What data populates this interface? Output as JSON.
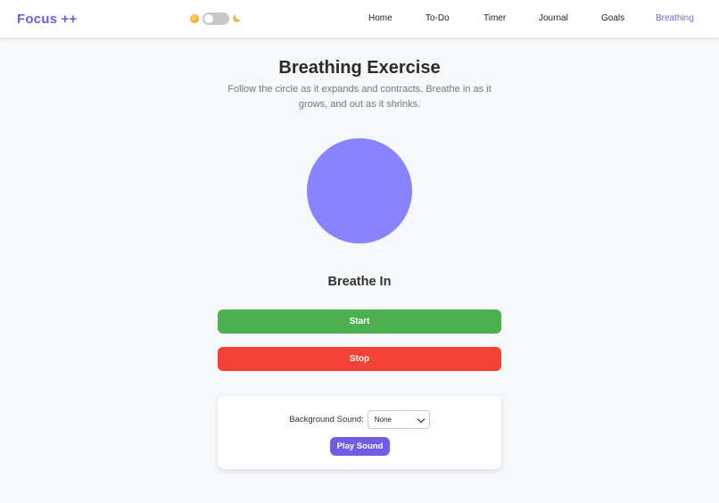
{
  "app": {
    "logo": "Focus ++"
  },
  "nav": {
    "items": [
      {
        "label": "Home",
        "active": false
      },
      {
        "label": "To-Do",
        "active": false
      },
      {
        "label": "Timer",
        "active": false
      },
      {
        "label": "Journal",
        "active": false
      },
      {
        "label": "Goals",
        "active": false
      },
      {
        "label": "Breathing",
        "active": true
      }
    ]
  },
  "theme": {
    "sun_icon": "sun-icon",
    "moon_icon": "moon-icon",
    "dark_mode": false
  },
  "main": {
    "title": "Breathing Exercise",
    "subtitle": "Follow the circle as it expands and contracts. Breathe in as it grows, and out as it shrinks.",
    "phase": "Breathe In",
    "start_label": "Start",
    "stop_label": "Stop"
  },
  "sound": {
    "label": "Background Sound:",
    "selected": "None",
    "play_label": "Play Sound"
  },
  "colors": {
    "accent": "#6f5fd6",
    "circle": "#8884ff",
    "start": "#4caf50",
    "stop": "#f44138",
    "play": "#6e5ee6"
  }
}
